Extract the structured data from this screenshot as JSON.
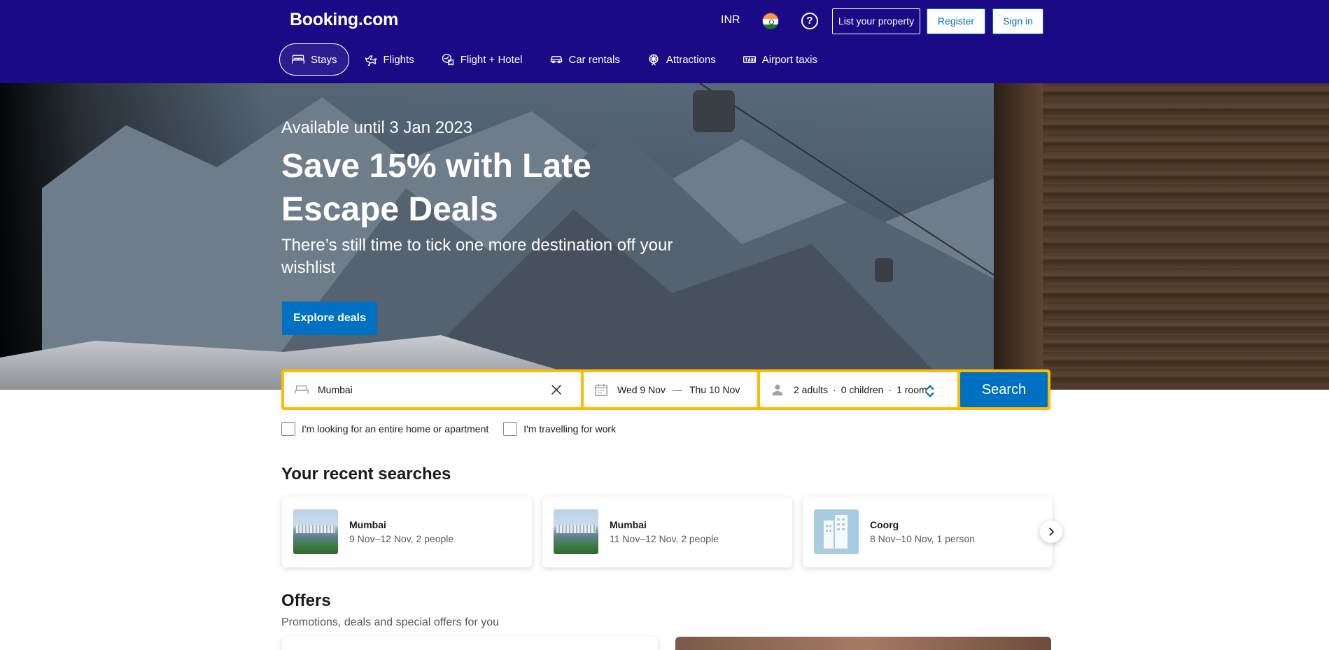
{
  "header": {
    "logo": "Booking.com",
    "currency": "INR",
    "help_glyph": "?",
    "list_property": "List your property",
    "register": "Register",
    "sign_in": "Sign in"
  },
  "nav": {
    "items": [
      {
        "label": "Stays",
        "icon": "bed-icon",
        "active": true
      },
      {
        "label": "Flights",
        "icon": "plane-icon"
      },
      {
        "label": "Flight + Hotel",
        "icon": "flight-hotel-icon"
      },
      {
        "label": "Car rentals",
        "icon": "car-icon"
      },
      {
        "label": "Attractions",
        "icon": "attractions-icon"
      },
      {
        "label": "Airport taxis",
        "icon": "taxi-icon"
      }
    ]
  },
  "hero": {
    "subtitle": "Available until 3 Jan 2023",
    "title": "Save 15% with Late Escape Deals",
    "description": "There’s still time to tick one more destination off your wishlist",
    "cta": "Explore deals"
  },
  "search": {
    "destination": "Mumbai",
    "checkin": "Wed 9 Nov",
    "dash": "—",
    "checkout": "Thu 10 Nov",
    "adults": "2 adults",
    "children": "0 children",
    "rooms": "1 room",
    "separator": "·",
    "button": "Search",
    "options": [
      "I'm looking for an entire home or apartment",
      "I'm travelling for work"
    ]
  },
  "recent": {
    "title": "Your recent searches",
    "items": [
      {
        "name": "Mumbai",
        "meta": "9 Nov–12 Nov, 2 people"
      },
      {
        "name": "Mumbai",
        "meta": "11 Nov–12 Nov, 2 people"
      },
      {
        "name": "Coorg",
        "meta": "8 Nov–10 Nov, 1 person"
      }
    ]
  },
  "offers": {
    "title": "Offers",
    "subtitle": "Promotions, deals and special offers for you"
  },
  "colors": {
    "brand_dark": "#1b0a86",
    "brand_blue": "#0071c2",
    "search_yellow": "#febb02"
  }
}
